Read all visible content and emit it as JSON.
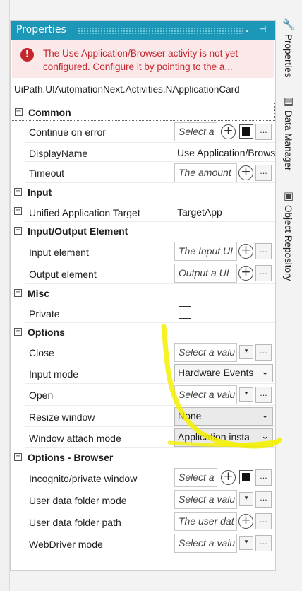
{
  "panel": {
    "title": "Properties",
    "dropdown_icon": "chevron-down-icon",
    "pin_icon": "pin-icon"
  },
  "error": {
    "icon": "error-icon",
    "message": "The Use Application/Browser activity is not yet configured. Configure it by pointing to the a..."
  },
  "activity_type": "UiPath.UIAutomationNext.Activities.NApplicationCard",
  "categories": {
    "common": "Common",
    "input": "Input",
    "io_element": "Input/Output Element",
    "misc": "Misc",
    "options": "Options",
    "options_browser": "Options - Browser"
  },
  "props": {
    "continue_on_error": {
      "name": "Continue on error",
      "value": "Select a"
    },
    "display_name": {
      "name": "DisplayName",
      "value": "Use Application/Browser"
    },
    "timeout": {
      "name": "Timeout",
      "value": "The amount"
    },
    "unified_target": {
      "name": "Unified Application Target",
      "value": "TargetApp"
    },
    "input_element": {
      "name": "Input element",
      "value": "The Input UI"
    },
    "output_element": {
      "name": "Output element",
      "value": "Output a UI"
    },
    "private": {
      "name": "Private",
      "checked": false
    },
    "close": {
      "name": "Close",
      "value": "Select a valu"
    },
    "input_mode": {
      "name": "Input mode",
      "value": "Hardware Events"
    },
    "open": {
      "name": "Open",
      "value": "Select a valu"
    },
    "resize_window": {
      "name": "Resize window",
      "value": "None"
    },
    "window_attach_mode": {
      "name": "Window attach mode",
      "value": "Application insta"
    },
    "incognito": {
      "name": "Incognito/private window",
      "value": "Select a"
    },
    "user_data_folder_mode": {
      "name": "User data folder mode",
      "value": "Select a valu"
    },
    "user_data_folder_path": {
      "name": "User data folder path",
      "value": "The user dat"
    },
    "webdriver_mode": {
      "name": "WebDriver mode",
      "value": "Select a valu"
    }
  },
  "buttons": {
    "dots": "...",
    "plus": "+",
    "dropdown": "▾"
  },
  "rail": {
    "properties": "Properties",
    "data_manager": "Data Manager",
    "object_repository": "Object Repository"
  },
  "colors": {
    "title_bar": "#1c97b7",
    "error_bg": "#fbe9e9",
    "error_text": "#c4262e",
    "highlighter": "#f4f000"
  }
}
